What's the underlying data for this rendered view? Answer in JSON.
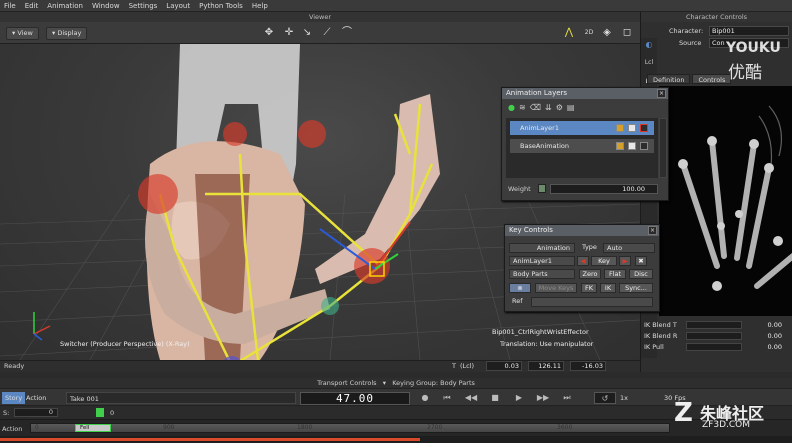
{
  "menu": [
    "File",
    "Edit",
    "Animation",
    "Window",
    "Settings",
    "Layout",
    "Python Tools",
    "Help"
  ],
  "viewer": {
    "title": "Viewer",
    "view_btn": "View",
    "display_btn": "Display",
    "camera_label": "Switcher (Producer Perspective) (X-Ray)",
    "selection_label": "Bip001_CtrlRightWristEffector",
    "translation_label": "Translation: Use manipulator",
    "mode_2d": "2D"
  },
  "status": {
    "ready": "Ready",
    "t_label": "T",
    "lcl_label": "(Lcl)",
    "x": "0.03",
    "y": "126.11",
    "z": "-16.03"
  },
  "character_controls": {
    "title": "Character Controls",
    "character_label": "Character:",
    "character_value": "Bip001",
    "source_label": "Source",
    "source_value": "Con",
    "tabs": [
      "Definition",
      "Controls"
    ],
    "lcl_label": "Lcl",
    "ik_rows": [
      {
        "label": "IK Blend T",
        "value": "0.00"
      },
      {
        "label": "IK Blend R",
        "value": "0.00"
      },
      {
        "label": "IK Pull",
        "value": "0.00"
      }
    ]
  },
  "watermark": {
    "youku": "YOUKU",
    "youku_cn": "优酷",
    "zf3d": "朱峰社区",
    "zf3d_url": "ZF3D.COM"
  },
  "animation_layers": {
    "title": "Animation Layers",
    "layers": [
      {
        "name": "AnimLayer1",
        "selected": true
      },
      {
        "name": "BaseAnimation",
        "selected": false
      }
    ],
    "weight_label": "Weight",
    "weight_value": "100.00"
  },
  "key_controls": {
    "title": "Key Controls",
    "animation_label": "Animation",
    "type_label": "Type",
    "type_value": "Auto",
    "layer_value": "AnimLayer1",
    "key_btn": "Key",
    "body_parts": "Body Parts",
    "zero_btn": "Zero",
    "flat_btn": "Flat",
    "disc_btn": "Disc",
    "move_keys": "Move Keys",
    "fk_btn": "FK",
    "ik_btn": "IK",
    "sync_btn": "Sync...",
    "ref_label": "Ref"
  },
  "transport": {
    "title": "Transport Controls",
    "keying_group": "Keying Group: Body Parts",
    "story": "Story",
    "action": "Action",
    "take": "Take 001",
    "frame": "47.00",
    "speed": "1x",
    "fps": "30 Fps",
    "s_label": "S:",
    "s_value": "0",
    "slider_value": "0",
    "action_label": "Action",
    "ticks": [
      "0",
      "900",
      "1800",
      "2700",
      "3600"
    ],
    "clip_label": "Fell"
  },
  "colors": {
    "selection": "#5b87c2",
    "accent_yellow": "#e8e23a",
    "accent_red": "#d83a2a"
  }
}
